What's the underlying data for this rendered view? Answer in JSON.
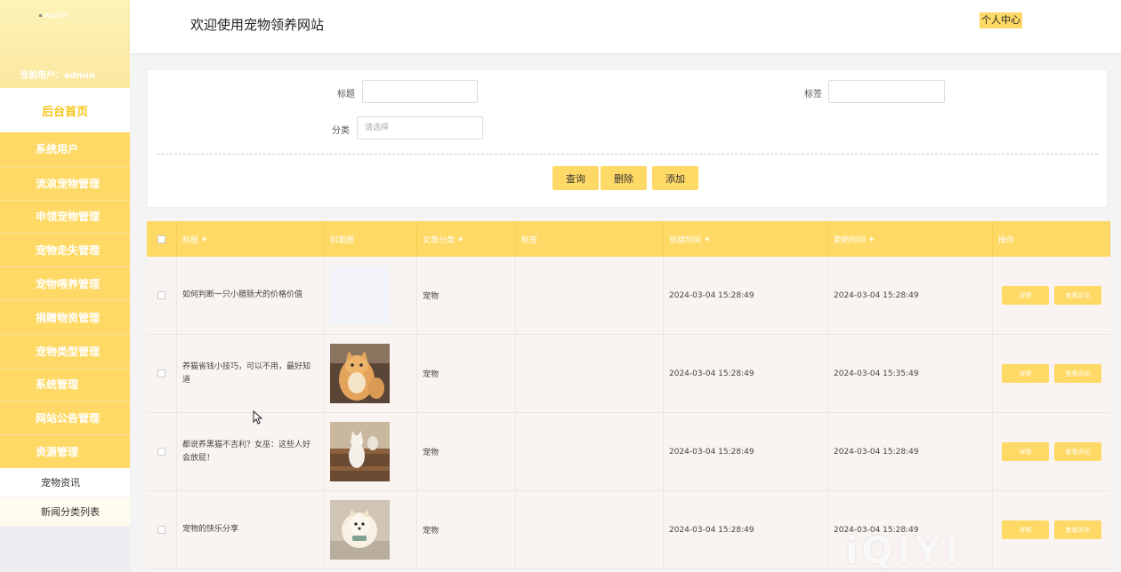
{
  "sidebar": {
    "logo": "water",
    "current_user": "当前用户：admin",
    "home": "后台首页",
    "menu": [
      "系统用户",
      "流浪宠物管理",
      "申领宠物管理",
      "宠物走失管理",
      "宠物喂养管理",
      "捐赠物资管理",
      "宠物类型管理",
      "系统管理",
      "网站公告管理",
      "资源管理"
    ],
    "sub_items": [
      "宠物资讯",
      "新闻分类列表"
    ]
  },
  "header": {
    "title": "欢迎使用宠物领养网站",
    "personal_center": "个人中心"
  },
  "search": {
    "title_label": "标题",
    "tag_label": "标签",
    "category_label": "分类",
    "category_placeholder": "请选择",
    "query_button": "查询",
    "delete_button": "删除",
    "add_button": "添加"
  },
  "table": {
    "headers": [
      "标题",
      "封面图",
      "文章分类",
      "标签",
      "创建时间",
      "更新时间",
      "操作"
    ],
    "detail_button": "详情",
    "review_button": "查看评论",
    "rows": [
      {
        "title": "如何判断一只小腊肠犬的价格价值",
        "category": "宠物",
        "tag": "",
        "created": "2024-03-04 15:28:49",
        "updated": "2024-03-04 15:28:49",
        "cover": "blank"
      },
      {
        "title": "养猫省钱小技巧，可以不用，最好知道",
        "category": "宠物",
        "tag": "",
        "created": "2024-03-04 15:28:49",
        "updated": "2024-03-04 15:35:49",
        "cover": "orange-cat"
      },
      {
        "title": "都说养黑猫不吉利？女巫：这些人好会放屁！",
        "category": "宠物",
        "tag": "",
        "created": "2024-03-04 15:28:49",
        "updated": "2024-03-04 15:28:49",
        "cover": "cat-stairs"
      },
      {
        "title": "宠物的快乐分享",
        "category": "宠物",
        "tag": "",
        "created": "2024-03-04 15:28:49",
        "updated": "2024-03-04 15:28:49",
        "cover": "pomeranian"
      }
    ]
  },
  "watermark": "iQIYI",
  "colors": {
    "accent": "#ffd966",
    "sidebar_head": "#fdf3b8",
    "row_bg": "#f9f4f1"
  }
}
